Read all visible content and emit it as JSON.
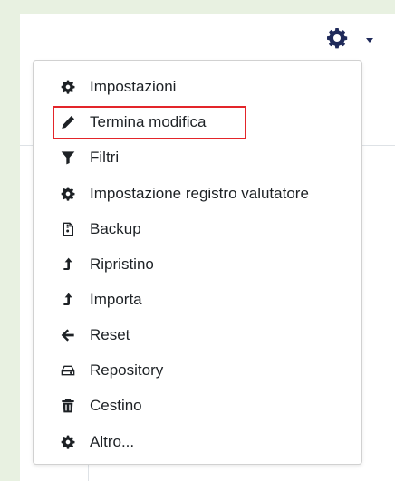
{
  "colors": {
    "background": "#e8f1e1",
    "icon": "#1d2125",
    "gear_accent": "#1f2a5a",
    "highlight_border": "#e3252a"
  },
  "header": {
    "gear_icon": "gear-icon",
    "caret_icon": "caret-down-icon"
  },
  "menu": {
    "items": [
      {
        "label": "Impostazioni",
        "icon": "gear-icon"
      },
      {
        "label": "Termina modifica",
        "icon": "pencil-icon"
      },
      {
        "label": "Filtri",
        "icon": "filter-icon"
      },
      {
        "label": "Impostazione registro valutatore",
        "icon": "gear-icon"
      },
      {
        "label": "Backup",
        "icon": "file-archive-icon"
      },
      {
        "label": "Ripristino",
        "icon": "level-up-icon"
      },
      {
        "label": "Importa",
        "icon": "level-up-icon"
      },
      {
        "label": "Reset",
        "icon": "arrow-left-icon"
      },
      {
        "label": "Repository",
        "icon": "hard-drive-icon"
      },
      {
        "label": "Cestino",
        "icon": "trash-icon"
      },
      {
        "label": "Altro...",
        "icon": "gear-icon"
      }
    ],
    "highlighted_index": 1
  }
}
